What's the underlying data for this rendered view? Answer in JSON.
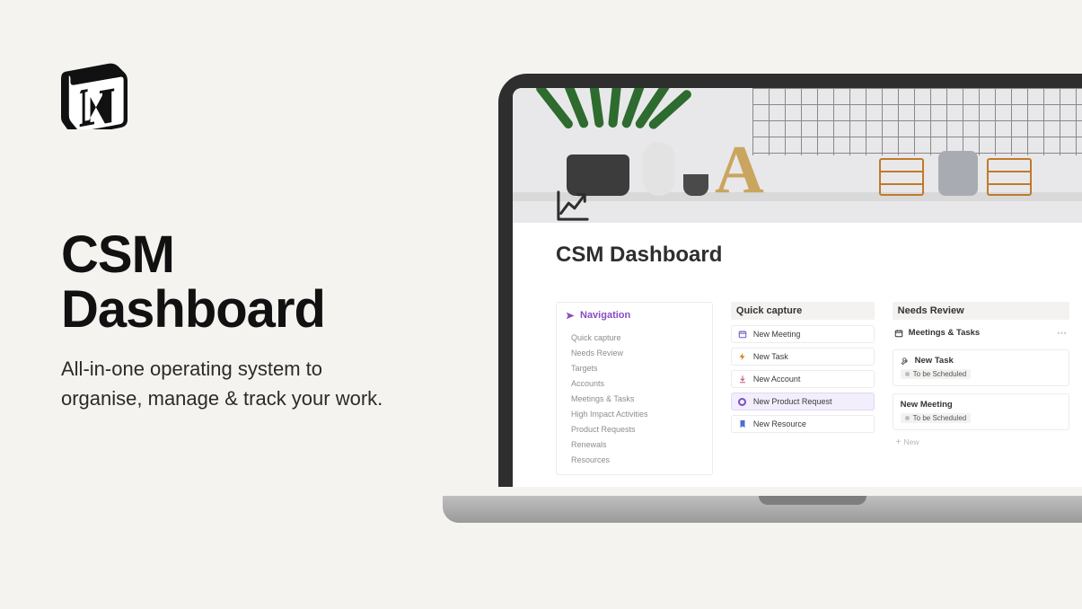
{
  "marketing": {
    "headline": "CSM Dashboard",
    "subhead": "All-in-one operating system to organise, manage & track your work."
  },
  "screen": {
    "page_title": "CSM Dashboard",
    "nav": {
      "heading": "Navigation",
      "items": [
        "Quick capture",
        "Needs Review",
        "Targets",
        "Accounts",
        "Meetings & Tasks",
        "High Impact Activities",
        "Product Requests",
        "Renewals",
        "Resources"
      ]
    },
    "quick_capture": {
      "heading": "Quick capture",
      "items": [
        {
          "icon": "calendar",
          "label": "New Meeting"
        },
        {
          "icon": "bolt",
          "label": "New Task"
        },
        {
          "icon": "download",
          "label": "New Account"
        },
        {
          "icon": "circle",
          "label": "New Product Request",
          "selected": true
        },
        {
          "icon": "bookmark",
          "label": "New Resource"
        }
      ]
    },
    "needs_review": {
      "heading": "Needs Review",
      "top": {
        "icon": "calendar",
        "label": "Meetings & Tasks"
      },
      "cards": [
        {
          "icon": "wrench",
          "title": "New Task",
          "status": "To be Scheduled"
        },
        {
          "icon": null,
          "title": "New Meeting",
          "status": "To be Scheduled"
        }
      ],
      "add_label": "New"
    }
  }
}
